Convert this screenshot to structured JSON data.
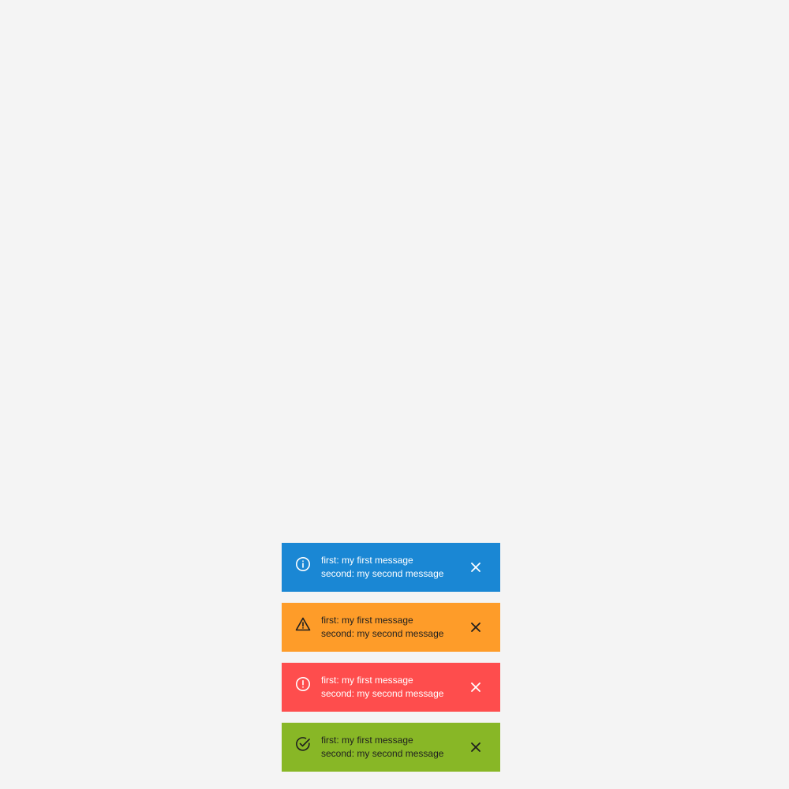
{
  "toasts": [
    {
      "type": "info",
      "icon": "info-circle-icon",
      "color": "#1a87d4",
      "line1": "first: my first message",
      "line2": "second: my second message"
    },
    {
      "type": "warning",
      "icon": "warning-triangle-icon",
      "color": "#fe9c29",
      "line1": "first: my first message",
      "line2": "second: my second message"
    },
    {
      "type": "error",
      "icon": "error-circle-icon",
      "color": "#fe4d4d",
      "line1": "first: my first message",
      "line2": "second: my second message"
    },
    {
      "type": "success",
      "icon": "check-circle-icon",
      "color": "#88b726",
      "line1": "first: my first message",
      "line2": "second: my second message"
    }
  ],
  "background_color": "#f4f4f4"
}
